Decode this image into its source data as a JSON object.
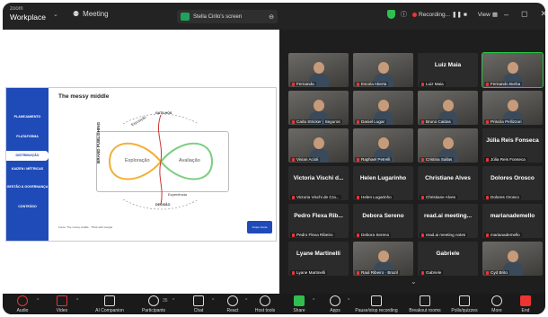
{
  "titlebar": {
    "brand_line1": "zoom",
    "brand_line2": "Workplace",
    "meeting_label": "Meeting",
    "share_tab_label": "Stella Cirilo's screen",
    "recording_label": "Recording...",
    "view_label": "View"
  },
  "slide": {
    "title": "The messy middle",
    "nav_items": [
      "PLANEJAMENTO",
      "PLATAFORMA",
      "DISTRIBUIÇÃO",
      "KAIZEN / MÉTRICAS",
      "GESTÃO & GOVERNANÇA",
      "CONTEÚDO"
    ],
    "active_nav_index": 2,
    "brand_publishing": "BRAND PUBLISHING",
    "exploracao": "Exploração",
    "avaliacao": "Avaliação",
    "exposicao": "Exposição",
    "gatilhos": "GATILHOS",
    "experiencia": "Experiência",
    "decisao": "DECISÃO",
    "footer": "Fonte: The messy middle · Think with Google",
    "logo_text": "Grupo Fonte"
  },
  "participants": [
    {
      "name": "Fernanda",
      "video": true
    },
    {
      "name": "Escola Aberta",
      "video": true
    },
    {
      "name": "Luiz Maia",
      "video": false,
      "big": "Luiz Maia"
    },
    {
      "name": "Fernando Borba",
      "video": true,
      "speaking": true
    },
    {
      "name": "Carla Stricker | Seguros",
      "video": true
    },
    {
      "name": "Daniel Lugar",
      "video": true
    },
    {
      "name": "Bruno Caldas",
      "video": true
    },
    {
      "name": "Priscila Pellizzari",
      "video": true
    },
    {
      "name": "Vivian Acioli",
      "video": true
    },
    {
      "name": "Raphael Petrelli",
      "video": true
    },
    {
      "name": "Cristina Sallas",
      "video": true
    },
    {
      "name": "Júlia Reis Fonseca",
      "video": false,
      "big": "Júlia Reis Fonseca"
    },
    {
      "name": "Victoria Vischi de Cra...",
      "video": false,
      "big": "Victoria Vischi d..."
    },
    {
      "name": "Helen Lugarinho",
      "video": false,
      "big": "Helen Lugarinho"
    },
    {
      "name": "Christiane Alves",
      "video": false,
      "big": "Christiane Alves"
    },
    {
      "name": "Dolores Orosco",
      "video": false,
      "big": "Dolores Orosco"
    },
    {
      "name": "Pedro Flexa Ribeiro",
      "video": false,
      "big": "Pedro Flexa Rib..."
    },
    {
      "name": "Debora Sereno",
      "video": false,
      "big": "Debora Sereno"
    },
    {
      "name": "read.ai meeting notes",
      "video": false,
      "big": "read.ai meeting..."
    },
    {
      "name": "marianademello",
      "video": false,
      "big": "marianademello"
    },
    {
      "name": "Lyane Martinelli",
      "video": false,
      "big": "Lyane Martinelli"
    },
    {
      "name": "Raul Ribeiro · Brazil",
      "video": true
    },
    {
      "name": "Gabriele",
      "video": false,
      "big": "Gabriele"
    },
    {
      "name": "Cyd Brito",
      "video": true
    }
  ],
  "toolbar": [
    "Audio",
    "Video",
    "AI Companion",
    "Participants",
    "Chat",
    "React",
    "Host tools",
    "Share",
    "Apps",
    "Pause/stop recording",
    "Breakout rooms",
    "Polls/quizzes",
    "More",
    "End"
  ],
  "participants_count": "35",
  "colors": {
    "accent": "#1f4bb8",
    "speaking": "#27c93f",
    "muted": "#e33333",
    "share_green": "#1fa35a"
  }
}
